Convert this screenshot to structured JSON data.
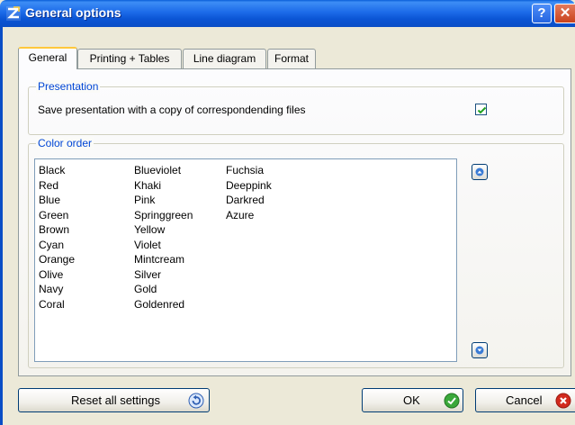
{
  "window": {
    "title": "General options",
    "help_label": "?",
    "close_label": "✕"
  },
  "tabs": [
    {
      "label": "General",
      "active": true
    },
    {
      "label": "Printing + Tables",
      "active": false
    },
    {
      "label": "Line diagram",
      "active": false
    },
    {
      "label": "Format",
      "active": false
    }
  ],
  "presentation": {
    "group_label": "Presentation",
    "checkbox_label": "Save presentation with a copy of correspondending files",
    "checked": true
  },
  "color_order": {
    "group_label": "Color order",
    "columns": [
      [
        "Black",
        "Red",
        "Blue",
        "Green",
        "Brown",
        "Cyan",
        "Orange",
        "Olive",
        "Navy",
        "Coral"
      ],
      [
        "Blueviolet",
        "Khaki",
        "Pink",
        "Springgreen",
        "Yellow",
        "Violet",
        "Mintcream",
        "Silver",
        "Gold",
        "Goldenred"
      ],
      [
        "Fuchsia",
        "Deeppink",
        "Darkred",
        "Azure"
      ]
    ]
  },
  "buttons": {
    "reset_label": "Reset all settings",
    "ok_label": "OK",
    "cancel_label": "Cancel"
  },
  "icons": {
    "app": "app-icon",
    "up": "arrow-up-icon",
    "down": "arrow-down-icon",
    "reset": "undo-icon",
    "ok": "checkmark-icon",
    "cancel": "cancel-x-icon"
  },
  "colors": {
    "titlebar": "#0a5fd8",
    "group_label": "#0046d5",
    "ok_green": "#3aa83a",
    "cancel_red": "#d22a1e"
  }
}
